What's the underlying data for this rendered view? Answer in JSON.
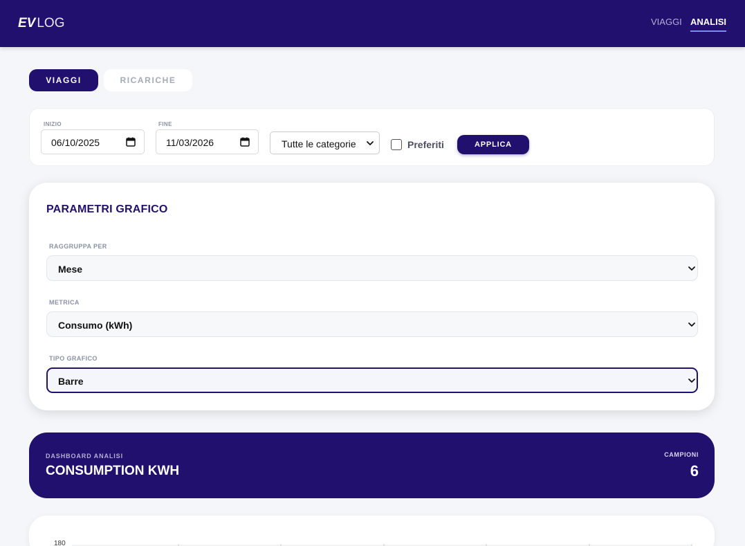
{
  "header": {
    "logo_bold": "EV",
    "logo_light": "LOG",
    "nav": [
      {
        "label": "VIAGGI",
        "active": false
      },
      {
        "label": "ANALISI",
        "active": true
      }
    ],
    "bg_color": "#22106e"
  },
  "tabs": [
    {
      "label": "VIAGGI",
      "active": true
    },
    {
      "label": "RICARICHE",
      "active": false
    }
  ],
  "filters": {
    "start_label": "INIZIO",
    "start_value": "06/10/2025",
    "end_label": "FINE",
    "end_value": "11/03/2026",
    "category_value": "Tutte le categorie",
    "favorites_label": "Preferiti",
    "favorites_checked": false,
    "apply_label": "APPLICA"
  },
  "params": {
    "title": "PARAMETRI GRAFICO",
    "group_by_label": "RAGGRUPPA PER",
    "group_by_value": "Mese",
    "metric_label": "METRICA",
    "metric_value": "Consumo (kWh)",
    "chart_type_label": "TIPO GRAFICO",
    "chart_type_value": "Barre"
  },
  "dashboard": {
    "subtitle": "DASHBOARD ANALISI",
    "title": "CONSUMPTION KWH",
    "samples_label": "CAMPIONI",
    "samples_value": "6"
  },
  "chart": {
    "top_tick": "180"
  },
  "icons": {
    "date_picker": "calendar-icon",
    "select": "chevron-down-icon"
  }
}
